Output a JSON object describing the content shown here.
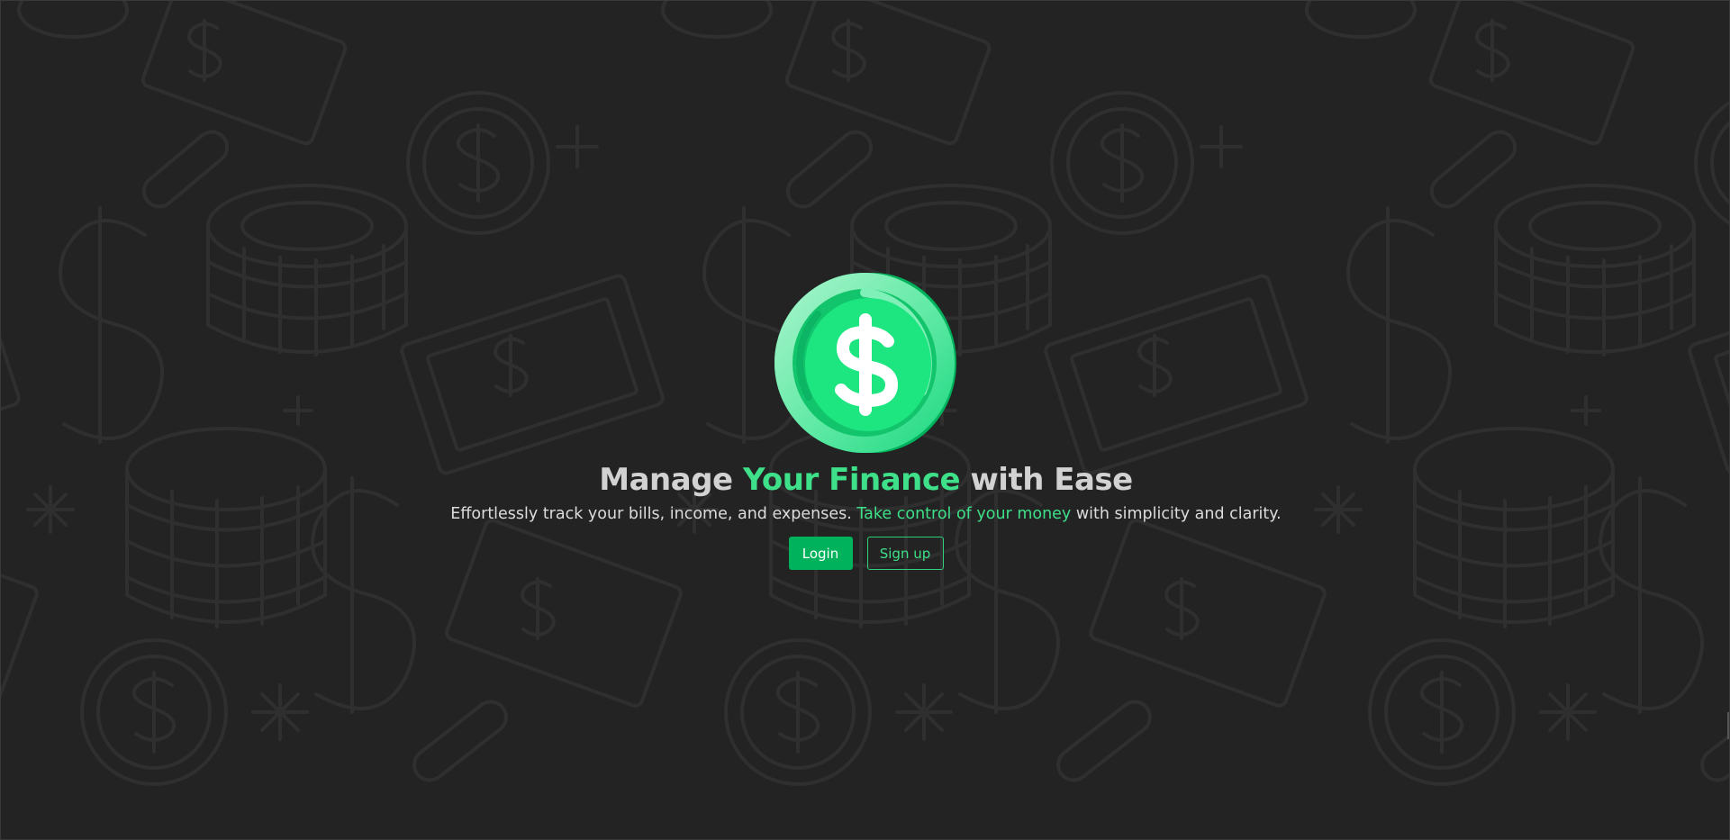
{
  "hero": {
    "logo_icon": "dollar-coin-icon",
    "headline": {
      "part1": "Manage ",
      "accent": "Your Finance",
      "part2": " with Ease"
    },
    "subline": {
      "part1": "Effortlessly track your bills, income, and expenses. ",
      "accent": "Take control of your money",
      "part2": " with simplicity and clarity."
    }
  },
  "actions": {
    "login_label": "Login",
    "signup_label": "Sign up"
  },
  "colors": {
    "background": "#232323",
    "pattern_stroke": "#2f2f2f",
    "accent": "#3ee089",
    "primary_button": "#00b25b",
    "headline_text": "#d2d2d2"
  }
}
